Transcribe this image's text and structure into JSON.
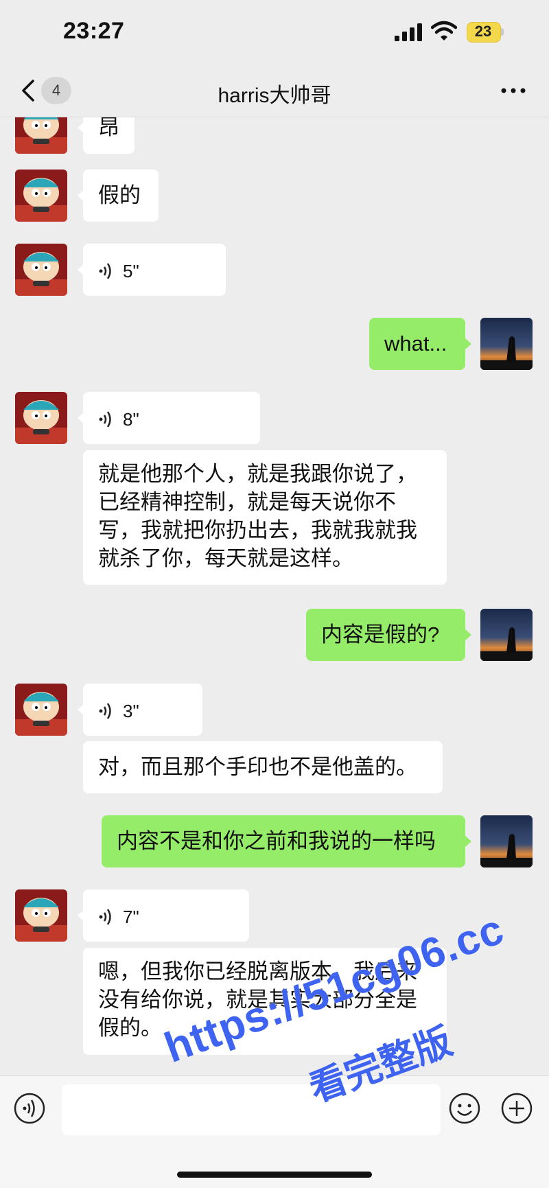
{
  "status_bar": {
    "time": "23:27",
    "battery": "23"
  },
  "nav": {
    "unread_count": "4",
    "title": "harris大帅哥"
  },
  "messages": [
    {
      "side": "left",
      "type": "text",
      "text": "昂"
    },
    {
      "side": "left",
      "type": "text",
      "text": "假的"
    },
    {
      "side": "left",
      "type": "voice",
      "duration": "5\""
    },
    {
      "side": "right",
      "type": "text",
      "text": "what..."
    },
    {
      "side": "left",
      "type": "voice",
      "duration": "8\""
    },
    {
      "side": "left",
      "type": "text",
      "text": "就是他那个人，就是我跟你说了，已经精神控制，就是每天说你不写，我就把你扔出去，我就我就我就杀了你，每天就是这样。"
    },
    {
      "side": "right",
      "type": "text",
      "text": "内容是假的?"
    },
    {
      "side": "left",
      "type": "voice",
      "duration": "3\""
    },
    {
      "side": "left",
      "type": "text",
      "text": "对，而且那个手印也不是他盖的。"
    },
    {
      "side": "right",
      "type": "text",
      "text": "内容不是和你之前和我说的一样吗"
    },
    {
      "side": "left",
      "type": "voice",
      "duration": "7\""
    },
    {
      "side": "left",
      "type": "text",
      "text": "嗯，但我你已经脱离版本，我后来没有给你说，就是其实大部分全是假的。"
    }
  ],
  "watermark": {
    "line1": "https://51cg06.cc",
    "line2": "看完整版"
  },
  "colors": {
    "background": "#ededed",
    "bubble_me": "#95ec69",
    "bubble_other": "#ffffff",
    "watermark": "#3d63f0"
  }
}
